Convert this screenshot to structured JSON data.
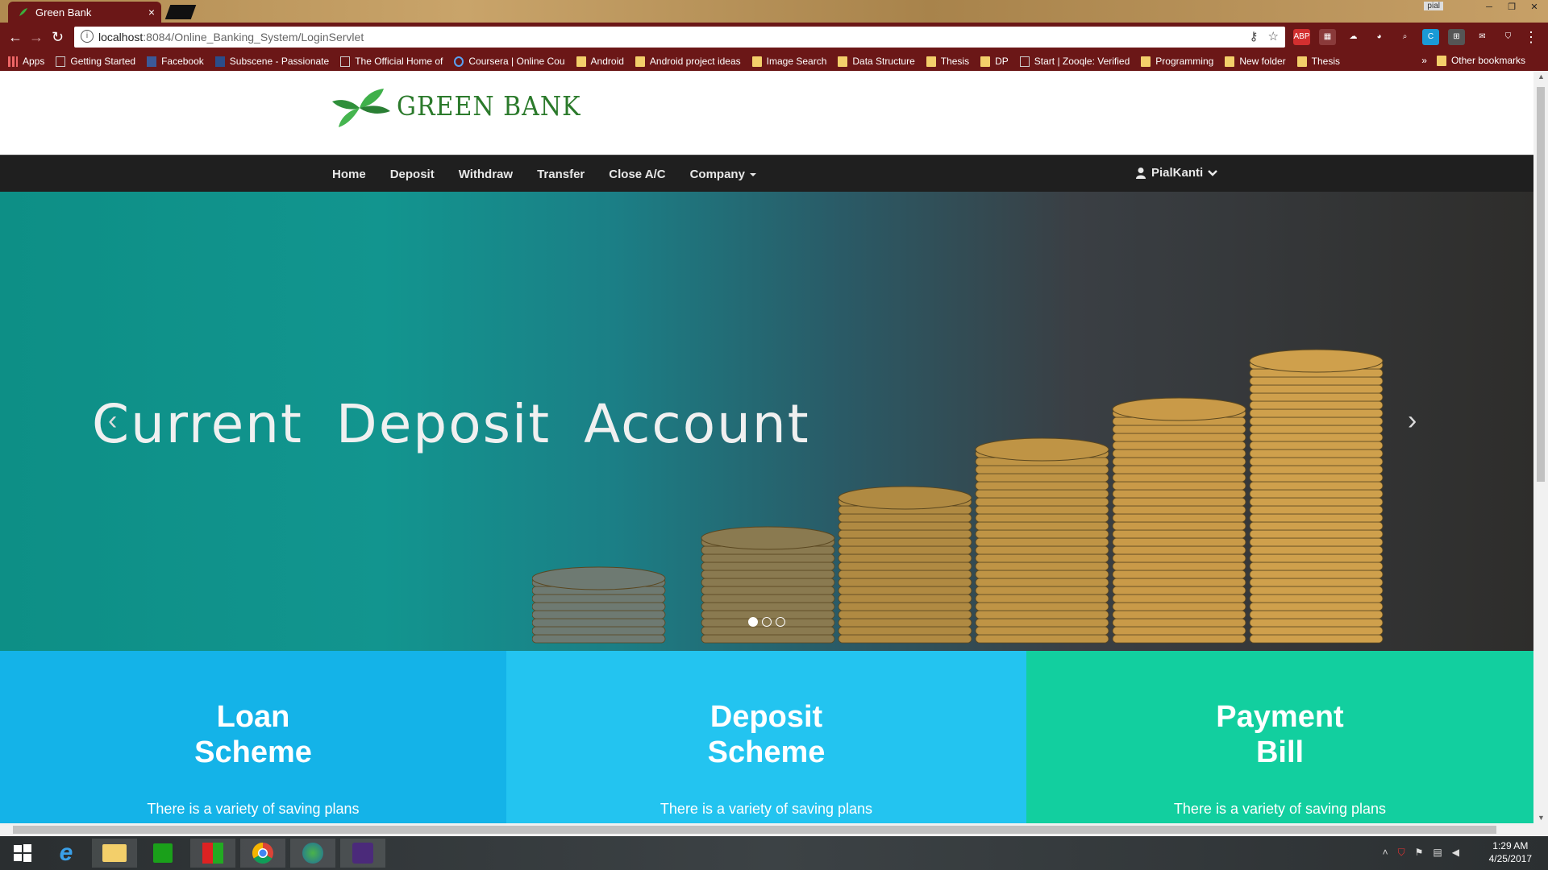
{
  "browser": {
    "tab_title": "Green Bank",
    "tab_close": "×",
    "profile": "pial",
    "url_host": "localhost",
    "url_rest": ":8084/Online_Banking_System/LoginServlet",
    "bookmarks": [
      {
        "label": "Apps",
        "icon": "apps-grid-icon"
      },
      {
        "label": "Getting Started",
        "icon": "page-icon"
      },
      {
        "label": "Facebook",
        "icon": "facebook-icon"
      },
      {
        "label": "Subscene - Passionate",
        "icon": "subscene-icon"
      },
      {
        "label": "The Official Home of",
        "icon": "site-icon"
      },
      {
        "label": "Coursera | Online Cou",
        "icon": "coursera-icon"
      },
      {
        "label": "Android",
        "icon": "folder-icon"
      },
      {
        "label": "Android project ideas",
        "icon": "folder-icon"
      },
      {
        "label": "Image Search",
        "icon": "folder-icon"
      },
      {
        "label": "Data Structure",
        "icon": "folder-icon"
      },
      {
        "label": "Thesis",
        "icon": "folder-icon"
      },
      {
        "label": "DP",
        "icon": "folder-icon"
      },
      {
        "label": "Start | Zooqle: Verified",
        "icon": "site-icon"
      },
      {
        "label": "Programming",
        "icon": "folder-icon"
      },
      {
        "label": "New folder",
        "icon": "folder-icon"
      },
      {
        "label": "Thesis",
        "icon": "folder-icon"
      }
    ],
    "more_bookmarks": "»",
    "other_bookmarks": "Other bookmarks"
  },
  "site": {
    "logo_text": "GREEN BANK",
    "nav": [
      "Home",
      "Deposit",
      "Withdraw",
      "Transfer",
      "Close A/C",
      "Company"
    ],
    "user": "PialKanti"
  },
  "carousel": {
    "caption": "Current Deposit Account",
    "prev": "‹",
    "next": "›",
    "slides": 3,
    "active_slide": 1
  },
  "features": [
    {
      "title_line1": "Loan",
      "title_line2": "Scheme",
      "text": "There is a variety of saving plans",
      "color": "#14b3e8"
    },
    {
      "title_line1": "Deposit",
      "title_line2": "Scheme",
      "text": "There is a variety of saving plans",
      "color": "#23c4f0"
    },
    {
      "title_line1": "Payment",
      "title_line2": "Bill",
      "text": "There is a variety of saving plans",
      "color": "#12cf9f"
    }
  ],
  "taskbar": {
    "time": "1:29 AM",
    "date": "4/25/2017"
  },
  "colors": {
    "browser_chrome": "#6b1717",
    "nav_bg": "#1f1f1f",
    "logo_green": "#2b7a2b"
  }
}
